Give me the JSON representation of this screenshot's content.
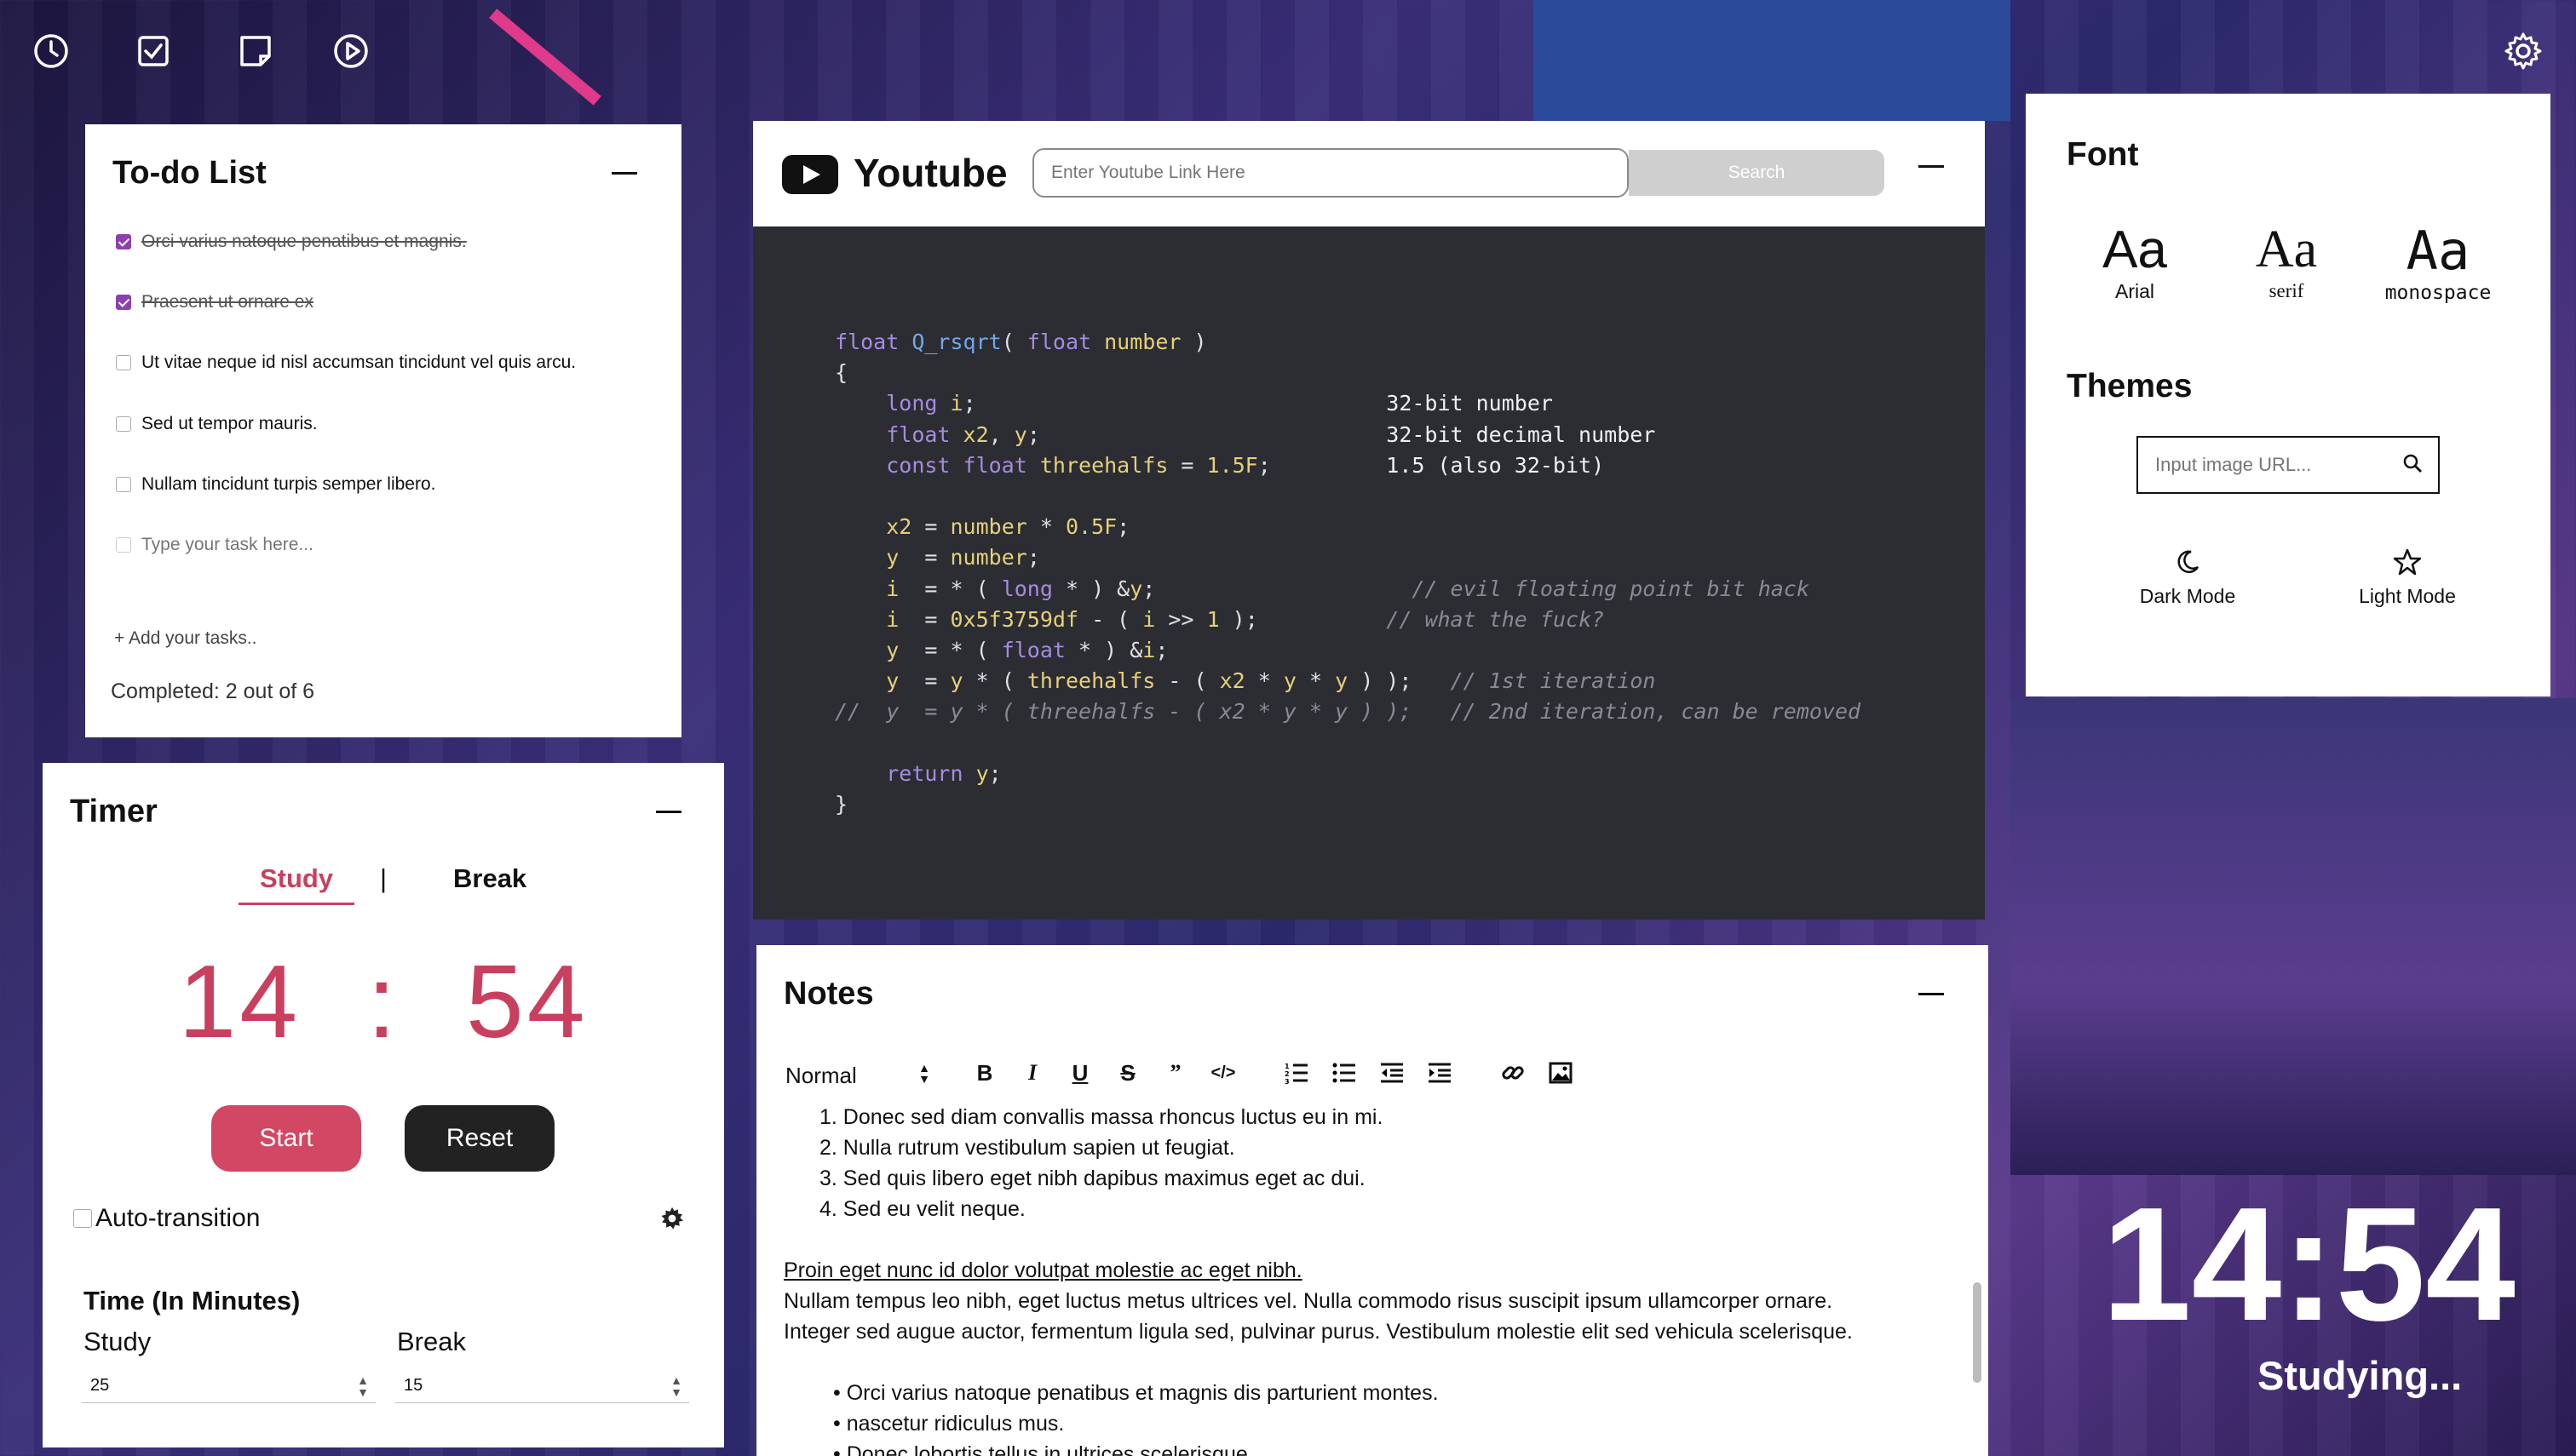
{
  "topbar": {
    "icons": [
      "clock-icon",
      "checkbox-icon",
      "sticky-note-icon",
      "play-circle-icon"
    ],
    "settings_icon": "gear-icon"
  },
  "todo": {
    "title": "To-do List",
    "tasks": [
      {
        "text": "Orci varius natoque penatibus et magnis.",
        "done": true
      },
      {
        "text": "Praesent ut ornare ex",
        "done": true
      },
      {
        "text": "Ut vitae neque id nisl accumsan tincidunt vel quis arcu.",
        "done": false
      },
      {
        "text": "Sed ut tempor mauris.",
        "done": false
      },
      {
        "text": "Nullam tincidunt turpis semper libero.",
        "done": false
      }
    ],
    "placeholder": "Type your task here...",
    "add_label": "+ Add your tasks..",
    "completed": "Completed: 2 out of 6"
  },
  "timer": {
    "title": "Timer",
    "tab_study": "Study",
    "tab_divider": "|",
    "tab_break": "Break",
    "minutes": "14",
    "colon": ":",
    "seconds": "54",
    "start": "Start",
    "reset": "Reset",
    "auto_transition": "Auto-transition",
    "section_title": "Time (In Minutes)",
    "study_label": "Study",
    "break_label": "Break",
    "study_value": "25",
    "break_value": "15"
  },
  "youtube": {
    "title": "Youtube",
    "placeholder": "Enter Youtube Link Here",
    "search": "Search"
  },
  "notes": {
    "title": "Notes",
    "format_select": "Normal",
    "ordered": [
      "Donec sed diam convallis massa rhoncus luctus eu in mi.",
      "Nulla rutrum vestibulum sapien ut feugiat.",
      "Sed quis libero eget nibh dapibus maximus eget ac dui.",
      "Sed eu velit neque."
    ],
    "link_text": "Proin eget nunc id dolor volutpat molestie ac eget nibh.",
    "para1": "Nullam tempus leo nibh, eget luctus metus ultrices vel. Nulla commodo risus suscipit ipsum ullamcorper ornare.",
    "para2": "Integer sed augue auctor, fermentum ligula sed, pulvinar purus. Vestibulum molestie elit sed vehicula scelerisque.",
    "bullets": [
      "Orci varius natoque penatibus et magnis dis parturient montes.",
      "nascetur ridiculus mus.",
      "Donec lobortis tellus in ultrices scelerisque."
    ]
  },
  "settings": {
    "font_title": "Font",
    "fonts": [
      {
        "sample": "Aa",
        "label": "Arial"
      },
      {
        "sample": "Aa",
        "label": "serif"
      },
      {
        "sample": "Aa",
        "label": "monospace"
      }
    ],
    "themes_title": "Themes",
    "url_placeholder": "Input image URL...",
    "dark_mode": "Dark Mode",
    "light_mode": "Light Mode"
  },
  "clock": {
    "time": "14:54",
    "status": "Studying..."
  },
  "colors": {
    "accent": "#c9405e",
    "checkbox": "#8e3fb0",
    "code_bg": "#2b2d33"
  }
}
